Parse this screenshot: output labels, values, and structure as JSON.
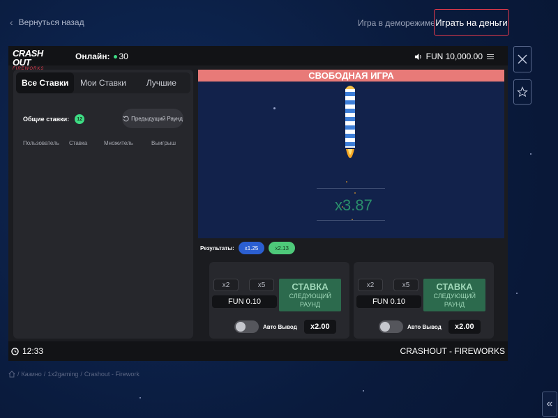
{
  "nav": {
    "back_label": "Вернуться назад",
    "demo_label": "Игра в деморежиме",
    "real_label": "Играть на деньги"
  },
  "game": {
    "logo_line1": "CRASH OUT",
    "logo_line2": "FIREWORKS",
    "online_label": "Онлайн:",
    "online_count": "30",
    "balance": "FUN 10,000.00",
    "tabs": [
      "Все Ставки",
      "Мои Ставки",
      "Лучшие"
    ],
    "total_bets_label": "Общие ставки:",
    "total_bets_count": "12",
    "prev_round_label": "Предыдущий Раунд",
    "columns": [
      "Пользователь",
      "Ставка",
      "Множитель",
      "Выигрыш"
    ],
    "free_game_banner": "СВОБОДНАЯ ИГРА",
    "multiplier": "x3.87",
    "results_label": "Результаты:",
    "results": [
      {
        "value": "x1.25",
        "color": "#2b5fd1"
      },
      {
        "value": "x2.13",
        "color": "#4ec97a"
      }
    ],
    "bet_panels": [
      {
        "q1": "x2",
        "q2": "x5",
        "amount": "FUN 0.10",
        "stake": "СТАВКА",
        "stake_sub": "СЛЕДУЮЩИЙ РАУНД",
        "auto_label": "Авто Вывод",
        "auto_value": "x2.00"
      },
      {
        "q1": "x2",
        "q2": "x5",
        "amount": "FUN 0.10",
        "stake": "СТАВКА",
        "stake_sub": "СЛЕДУЮЩИЙ РАУНД",
        "auto_label": "Авто Вывод",
        "auto_value": "x2.00"
      }
    ],
    "time": "12:33",
    "footer_title": "CRASHOUT - FIREWORKS"
  },
  "breadcrumb": [
    "Казино",
    "1x2gaming",
    "Crashout - Firework"
  ],
  "colors": {
    "accent_red": "#e0394b",
    "stake_green": "#2c6a4d",
    "banner": "#e87a78"
  },
  "icons": {
    "close": "close-icon",
    "favorite": "star-icon",
    "collapse": "double-chevron-left-icon"
  }
}
